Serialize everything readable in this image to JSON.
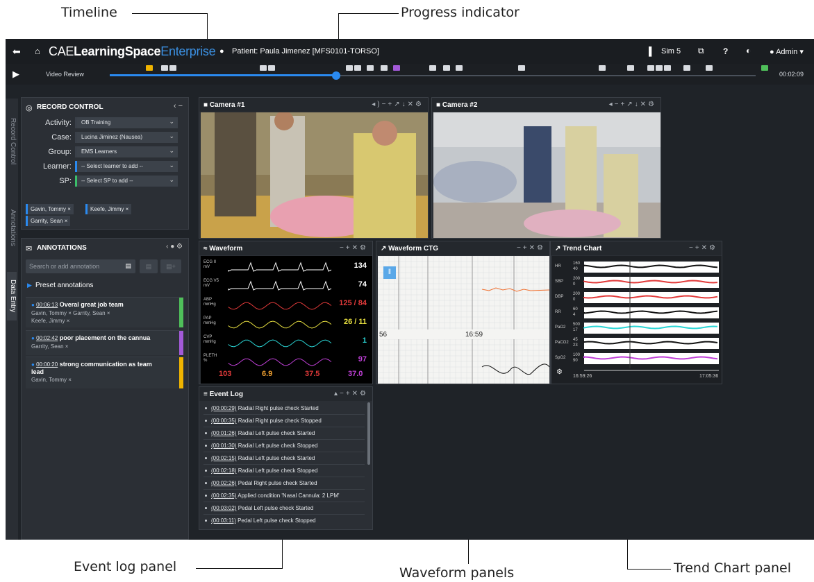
{
  "callouts": {
    "timeline": "Timeline",
    "progress": "Progress indicator",
    "event_log": "Event log panel",
    "waveform": "Waveform panels",
    "trend": "Trend Chart panel"
  },
  "topbar": {
    "brand_a": "CAE",
    "brand_b": "LearningSpace",
    "brand_c": "Enterprise",
    "patient": "Patient: Paula Jimenez [MFS0101-TORSO]",
    "sim": "Sim 5",
    "help": "?",
    "user": "Admin",
    "icons": [
      "back-arrow-icon",
      "home-icon",
      "user-icon",
      "door-icon",
      "window-icon",
      "contrast-icon"
    ]
  },
  "timeline": {
    "mode_label": "Video Review",
    "time": "00:02:09",
    "progress_fraction": 0.35
  },
  "vertical_tabs": [
    "Record Control",
    "Annotations",
    "Data Entry"
  ],
  "record_control": {
    "title": "RECORD CONTROL",
    "fields": [
      {
        "label": "Activity:",
        "value": "OB Training",
        "accent": "#3a4049"
      },
      {
        "label": "Case:",
        "value": "Lucina Jiminez (Nausea)",
        "accent": "#3a4049"
      },
      {
        "label": "Group:",
        "value": "EMS Learners",
        "accent": "#3a4049"
      },
      {
        "label": "Learner:",
        "value": "-- Select learner to add --",
        "accent": "#2a8af0"
      },
      {
        "label": "SP:",
        "value": "-- Select SP to add --",
        "accent": "#3bbf6a"
      }
    ],
    "tags": [
      "Gavin, Tommy ×",
      "Keefe, Jimmy ×",
      "Garrity, Sean ×"
    ]
  },
  "annotations": {
    "title": "ANNOTATIONS",
    "search_placeholder": "Search or add annotation",
    "preset": "Preset annotations",
    "items": [
      {
        "time": "00:06:13",
        "text": "Overal great job team",
        "people": "Gavin, Tommy ×   Garrity, Sean ×",
        "people2": "Keefe, Jimmy ×",
        "color": "#4fbf5a"
      },
      {
        "time": "00:02:42",
        "text": "poor placement on the cannua",
        "people": "Garrity, Sean ×",
        "people2": "",
        "color": "#a35ad8"
      },
      {
        "time": "00:00:20",
        "text": "strong communication as team",
        "text2": "lead",
        "people": "Gavin, Tommy ×",
        "color": "#f0b400"
      }
    ]
  },
  "cameras": [
    {
      "title": "Camera #1"
    },
    {
      "title": "Camera #2"
    }
  ],
  "waveform": {
    "title": "Waveform",
    "channels": [
      {
        "label": "ECG II",
        "unit": "mV",
        "color": "#ffffff",
        "value": "134",
        "vcolor": "#ffffff"
      },
      {
        "label": "ECG V5",
        "unit": "mV",
        "color": "#ffffff",
        "value": "74",
        "vcolor": "#ffffff"
      },
      {
        "label": "ABP",
        "unit": "mmHg",
        "color": "#e23a3a",
        "value": "125 / 84",
        "vcolor": "#e23a3a"
      },
      {
        "label": "PAP",
        "unit": "mmHg",
        "color": "#e8e040",
        "value": "26 / 11",
        "vcolor": "#e8e040"
      },
      {
        "label": "CVP",
        "unit": "mmHg",
        "color": "#2ad6d6",
        "value": "1",
        "vcolor": "#2ad6d6"
      },
      {
        "label": "PLETH",
        "unit": "%",
        "color": "#c040d8",
        "value": "97",
        "vcolor": "#c040d8"
      }
    ],
    "bottom": [
      {
        "value": "103",
        "color": "#e23a3a"
      },
      {
        "value": "6.9",
        "color": "#f0a030"
      },
      {
        "value": "37.5",
        "color": "#e23a3a"
      },
      {
        "value": "37.0",
        "color": "#c040d8"
      }
    ]
  },
  "ctg": {
    "title": "Waveform CTG",
    "left_label": "56",
    "time_label": "16:59"
  },
  "trend": {
    "title": "Trend Chart",
    "rows": [
      {
        "name": "HR",
        "hi": "160",
        "lo": "40",
        "color": "#ffffff"
      },
      {
        "name": "SBP",
        "hi": "200",
        "lo": "0",
        "color": "#e23a3a"
      },
      {
        "name": "DBP",
        "hi": "200",
        "lo": "0",
        "color": "#e23a3a"
      },
      {
        "name": "RR",
        "hi": "60",
        "lo": "4",
        "color": "#ffffff"
      },
      {
        "name": "PaO2",
        "hi": "500",
        "lo": "17",
        "color": "#2ad6d6"
      },
      {
        "name": "PaCO2",
        "hi": "45",
        "lo": "23",
        "color": "#ffffff"
      },
      {
        "name": "SpO2",
        "hi": "100",
        "lo": "90",
        "color": "#c040d8"
      }
    ],
    "start": "16:59:26",
    "end": "17:05:36"
  },
  "event_log": {
    "title": "Event Log",
    "items": [
      {
        "time": "(00:00:29)",
        "text": " Radial Right pulse check Started"
      },
      {
        "time": "(00:00:35)",
        "text": " Radial Right pulse check Stopped"
      },
      {
        "time": "(00:01:26)",
        "text": " Radial Left pulse check Started"
      },
      {
        "time": "(00:01:30)",
        "text": " Radial Left pulse check Stopped"
      },
      {
        "time": "(00:02:15)",
        "text": " Radial Left pulse check Started"
      },
      {
        "time": "(00:02:18)",
        "text": " Radial Left pulse check Stopped"
      },
      {
        "time": "(00:02:26)",
        "text": " Pedal Right pulse check Started"
      },
      {
        "time": "(00:02:35)",
        "text": " Applied condition 'Nasal Cannula: 2 LPM'"
      },
      {
        "time": "(00:03:02)",
        "text": " Pedal Left pulse check Started"
      },
      {
        "time": "(00:03:11)",
        "text": " Pedal Left pulse check Stopped"
      }
    ]
  }
}
